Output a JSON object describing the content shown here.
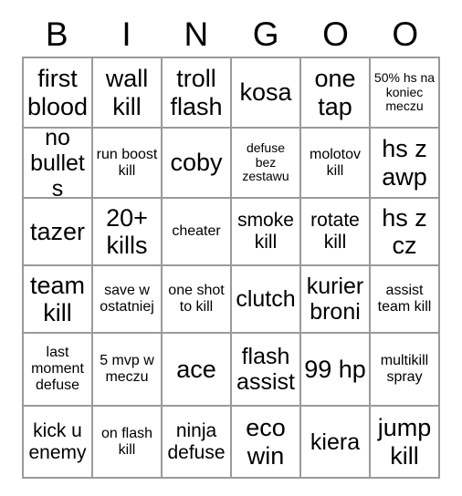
{
  "card": {
    "header_letters": [
      "B",
      "I",
      "N",
      "G",
      "O",
      "O"
    ],
    "rows": [
      [
        {
          "text": "first blood",
          "size": "fs-xl"
        },
        {
          "text": "wall kill",
          "size": "fs-xl"
        },
        {
          "text": "troll flash",
          "size": "fs-xl"
        },
        {
          "text": "kosa",
          "size": "fs-xl"
        },
        {
          "text": "one tap",
          "size": "fs-xl"
        },
        {
          "text": "50% hs na koniec meczu",
          "size": "fs-xs"
        }
      ],
      [
        {
          "text": "no bullets",
          "size": "fs-lg"
        },
        {
          "text": "run boost kill",
          "size": "fs-sm"
        },
        {
          "text": "coby",
          "size": "fs-xl"
        },
        {
          "text": "defuse bez zestawu",
          "size": "fs-xs"
        },
        {
          "text": "molotov kill",
          "size": "fs-sm"
        },
        {
          "text": "hs z awp",
          "size": "fs-xl"
        }
      ],
      [
        {
          "text": "tazer",
          "size": "fs-xl"
        },
        {
          "text": "20+ kills",
          "size": "fs-xl"
        },
        {
          "text": "cheater",
          "size": "fs-sm"
        },
        {
          "text": "smoke kill",
          "size": "fs-md"
        },
        {
          "text": "rotate kill",
          "size": "fs-md"
        },
        {
          "text": "hs z cz",
          "size": "fs-xl"
        }
      ],
      [
        {
          "text": "team kill",
          "size": "fs-xl"
        },
        {
          "text": "save w ostatniej",
          "size": "fs-sm"
        },
        {
          "text": "one shot to kill",
          "size": "fs-sm"
        },
        {
          "text": "clutch",
          "size": "fs-lg"
        },
        {
          "text": "kurier broni",
          "size": "fs-lg"
        },
        {
          "text": "assist team kill",
          "size": "fs-sm"
        }
      ],
      [
        {
          "text": "last moment defuse",
          "size": "fs-sm"
        },
        {
          "text": "5 mvp w meczu",
          "size": "fs-sm"
        },
        {
          "text": "ace",
          "size": "fs-xl"
        },
        {
          "text": "flash assist",
          "size": "fs-lg"
        },
        {
          "text": "99 hp",
          "size": "fs-xl"
        },
        {
          "text": "multikill spray",
          "size": "fs-sm"
        }
      ],
      [
        {
          "text": "kick u enemy",
          "size": "fs-md"
        },
        {
          "text": "on flash kill",
          "size": "fs-sm"
        },
        {
          "text": "ninja defuse",
          "size": "fs-md"
        },
        {
          "text": "eco win",
          "size": "fs-xl"
        },
        {
          "text": "kiera",
          "size": "fs-lg"
        },
        {
          "text": "jump kill",
          "size": "fs-xl"
        }
      ]
    ],
    "colors": {
      "grid_line": "#9a9a9a",
      "text": "#000000",
      "background": "#ffffff"
    }
  }
}
